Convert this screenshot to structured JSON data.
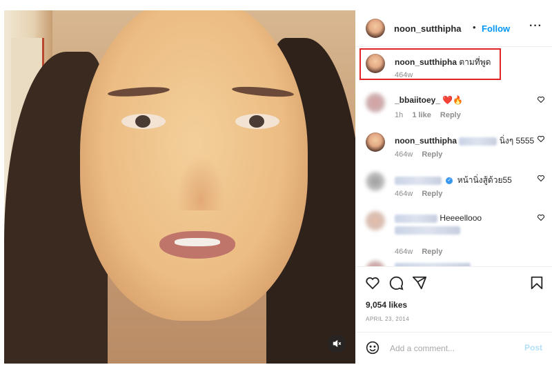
{
  "post": {
    "username": "noon_sutthipha",
    "follow_label": "Follow",
    "separator": "•",
    "more_label": "···"
  },
  "caption": {
    "username": "noon_sutthipha",
    "text": "ตามที่พูด",
    "time": "464w"
  },
  "comments": [
    {
      "username": "_bbaiitoey_",
      "text": "❤️🔥",
      "time": "1h",
      "likes": "1 like",
      "reply": "Reply"
    },
    {
      "username": "noon_sutthipha",
      "text": "นิ่งๆ 5555",
      "time": "464w",
      "reply": "Reply"
    },
    {
      "username": "",
      "text": "หน้านิ่งสู้ด้วย55",
      "time": "464w",
      "reply": "Reply"
    },
    {
      "username": "",
      "text": "Heeeellooo",
      "time": "464w",
      "reply": "Reply"
    }
  ],
  "stats": {
    "likes": "9,054 likes",
    "date": "APRIL 23, 2014"
  },
  "composer": {
    "placeholder": "Add a comment...",
    "post_label": "Post"
  },
  "colors": {
    "link": "#0095f6",
    "highlight": "#e02424",
    "post_disabled": "#b2dffc"
  },
  "icons": [
    "mute-icon",
    "more-icon",
    "heart-icon",
    "comment-icon",
    "share-icon",
    "bookmark-icon",
    "emoji-icon",
    "verified-icon"
  ]
}
